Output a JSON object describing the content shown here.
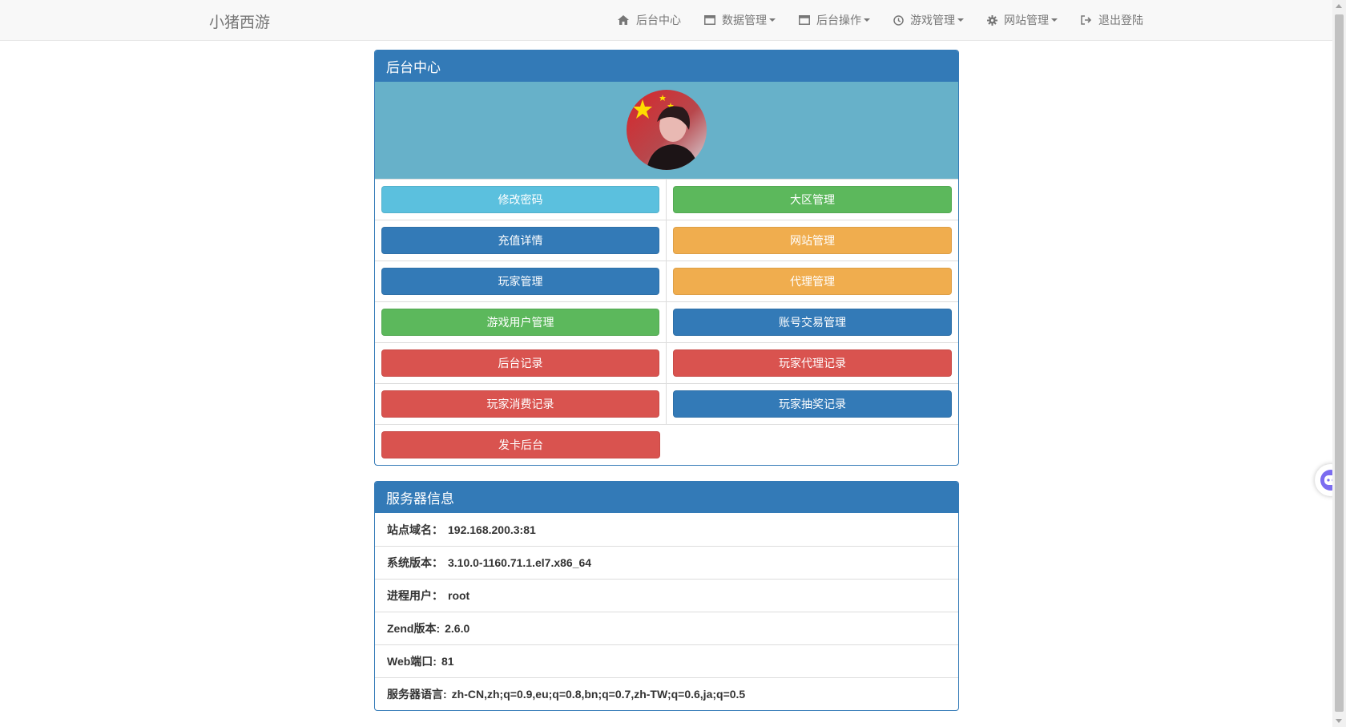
{
  "brand": "小猪西游",
  "nav": {
    "items": [
      {
        "label": "后台中心",
        "icon": "home-icon",
        "dropdown": false
      },
      {
        "label": "数据管理",
        "icon": "window-icon",
        "dropdown": true
      },
      {
        "label": "后台操作",
        "icon": "window-icon",
        "dropdown": true
      },
      {
        "label": "游戏管理",
        "icon": "clock-icon",
        "dropdown": true
      },
      {
        "label": "网站管理",
        "icon": "gear-icon",
        "dropdown": true
      },
      {
        "label": "退出登陆",
        "icon": "logout-icon",
        "dropdown": false
      }
    ]
  },
  "center_panel": {
    "title": "后台中心",
    "buttons": [
      {
        "label": "修改密码",
        "color": "#5bc0de"
      },
      {
        "label": "大区管理",
        "color": "#5cb85c"
      },
      {
        "label": "充值详情",
        "color": "#337ab7"
      },
      {
        "label": "网站管理",
        "color": "#f0ad4e"
      },
      {
        "label": "玩家管理",
        "color": "#337ab7"
      },
      {
        "label": "代理管理",
        "color": "#f0ad4e"
      },
      {
        "label": "游戏用户管理",
        "color": "#5cb85c"
      },
      {
        "label": "账号交易管理",
        "color": "#337ab7"
      },
      {
        "label": "后台记录",
        "color": "#d9534f"
      },
      {
        "label": "玩家代理记录",
        "color": "#d9534f"
      },
      {
        "label": "玩家消费记录",
        "color": "#d9534f"
      },
      {
        "label": "玩家抽奖记录",
        "color": "#337ab7"
      },
      {
        "label": "发卡后台",
        "color": "#d9534f"
      }
    ]
  },
  "server_panel": {
    "title": "服务器信息",
    "rows": [
      {
        "key": "站点域名：",
        "value": "192.168.200.3:81"
      },
      {
        "key": "系统版本：",
        "value": "3.10.0-1160.71.1.el7.x86_64"
      },
      {
        "key": "进程用户：",
        "value": "root"
      },
      {
        "key": "Zend版本:",
        "value": "2.6.0"
      },
      {
        "key": "Web端口:",
        "value": "81"
      },
      {
        "key": "服务器语言:",
        "value": "zh-CN,zh;q=0.9,eu;q=0.8,bn;q=0.7,zh-TW;q=0.6,ja;q=0.5"
      }
    ]
  },
  "colors": {
    "primary": "#337ab7",
    "info": "#5bc0de",
    "success": "#5cb85c",
    "warning": "#f0ad4e",
    "danger": "#d9534f",
    "avatar_bg": "#67b1c9"
  }
}
